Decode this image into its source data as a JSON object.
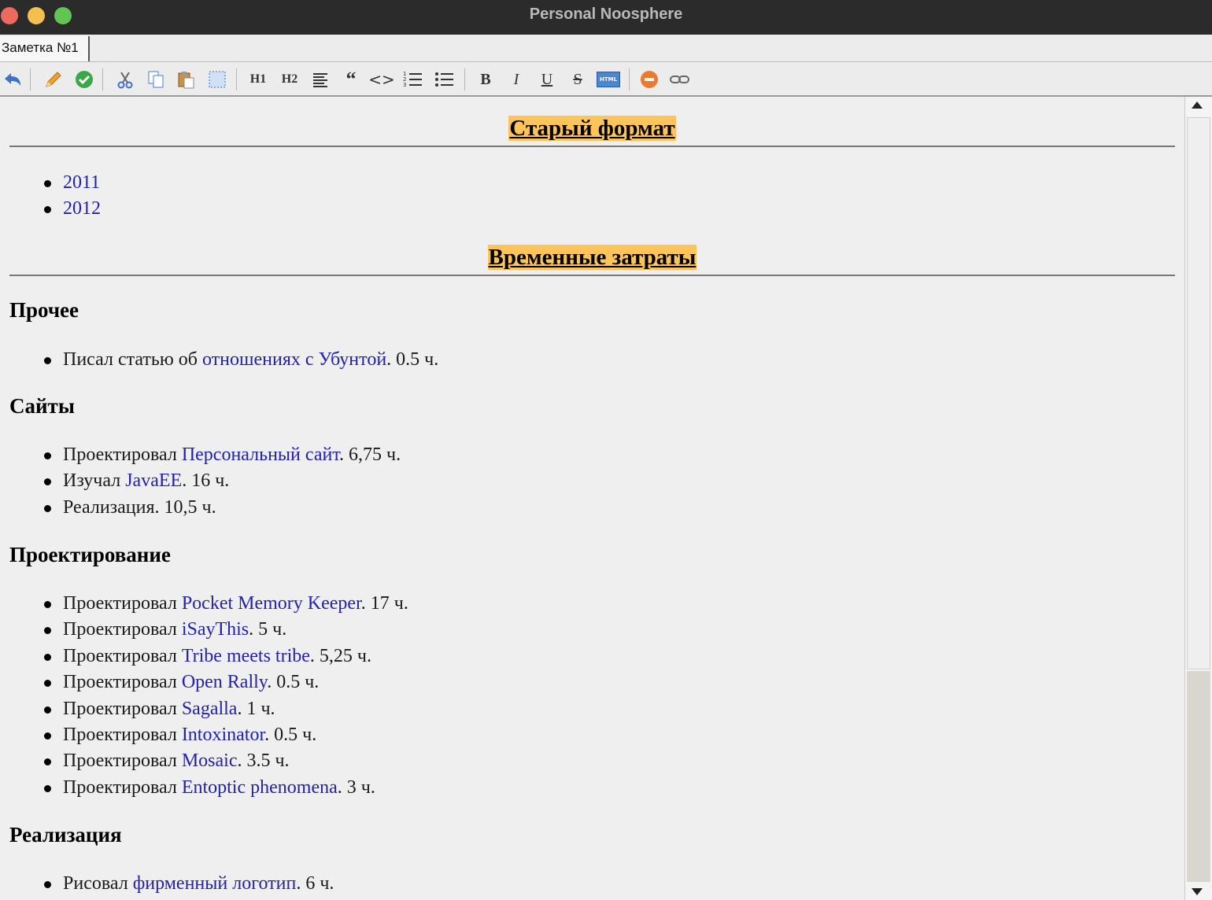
{
  "window": {
    "title": "Personal Noosphere"
  },
  "tabs": [
    {
      "label": "Заметка №1"
    }
  ],
  "toolbar": {
    "h1_label": "H1",
    "h2_label": "H2",
    "quote_label": "“",
    "code_label": "<>",
    "bold_label": "B",
    "italic_label": "I",
    "underline_label": "U",
    "strike_label": "S",
    "html_label": "HTML"
  },
  "document": {
    "section1_title": "Старый формат",
    "years": [
      "2011",
      "2012"
    ],
    "section2_title": "Временные затраты",
    "groups": [
      {
        "heading": "Прочее",
        "items": [
          {
            "pre": "Писал статью об ",
            "link": "отношениях с Убунтой",
            "post": ". 0.5 ч."
          }
        ]
      },
      {
        "heading": "Сайты",
        "items": [
          {
            "pre": "Проектировал ",
            "link": "Персональный сайт",
            "post": ". 6,75 ч."
          },
          {
            "pre": "Изучал ",
            "link": "JavaEE",
            "post": ". 16 ч."
          },
          {
            "pre": "Реализация. 10,5 ч.",
            "link": "",
            "post": ""
          }
        ]
      },
      {
        "heading": "Проектирование",
        "items": [
          {
            "pre": "Проектировал ",
            "link": "Pocket Memory Keeper",
            "post": ". 17 ч."
          },
          {
            "pre": "Проектировал ",
            "link": "iSayThis",
            "post": ". 5 ч."
          },
          {
            "pre": "Проектировал ",
            "link": "Tribe meets tribe",
            "post": ". 5,25 ч."
          },
          {
            "pre": "Проектировал ",
            "link": "Open Rally",
            "post": ". 0.5 ч."
          },
          {
            "pre": "Проектировал ",
            "link": "Sagalla",
            "post": ". 1 ч."
          },
          {
            "pre": "Проектировал ",
            "link": "Intoxinator",
            "post": ". 0.5 ч."
          },
          {
            "pre": "Проектировал ",
            "link": "Mosaic",
            "post": ". 3.5 ч."
          },
          {
            "pre": "Проектировал ",
            "link": "Entoptic phenomena",
            "post": ". 3 ч."
          }
        ]
      },
      {
        "heading": "Реализация",
        "items": [
          {
            "pre": "Рисовал ",
            "link": "фирменный логотип",
            "post": ". 6 ч."
          }
        ]
      }
    ]
  },
  "colors": {
    "heading_highlight": "#fcc45a",
    "link": "#2222aa",
    "titlebar": "#2b2b2b"
  }
}
